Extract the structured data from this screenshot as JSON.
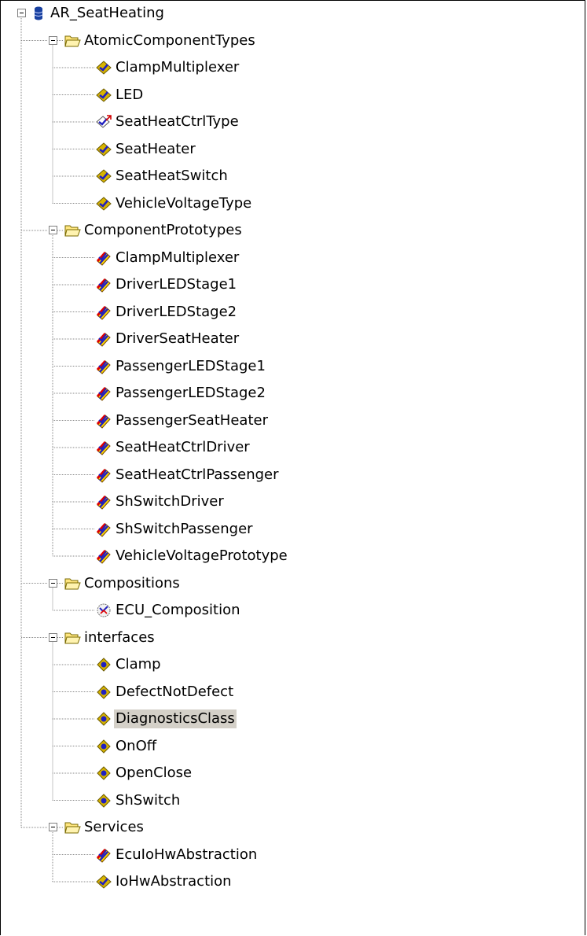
{
  "tree": {
    "root": {
      "label": "AR_SeatHeating",
      "icon": "database-icon",
      "expanded": true
    },
    "folders": [
      {
        "label": "AtomicComponentTypes",
        "icon": "folder-open-icon",
        "expanded": true,
        "items": [
          {
            "label": "ClampMultiplexer",
            "icon": "component-type-icon"
          },
          {
            "label": "LED",
            "icon": "component-type-icon"
          },
          {
            "label": "SeatHeatCtrlType",
            "icon": "application-component-type-icon"
          },
          {
            "label": "SeatHeater",
            "icon": "component-type-icon"
          },
          {
            "label": "SeatHeatSwitch",
            "icon": "component-type-icon"
          },
          {
            "label": "VehicleVoltageType",
            "icon": "component-type-icon"
          }
        ]
      },
      {
        "label": "ComponentPrototypes",
        "icon": "folder-open-icon",
        "expanded": true,
        "items": [
          {
            "label": "ClampMultiplexer",
            "icon": "component-prototype-icon"
          },
          {
            "label": "DriverLEDStage1",
            "icon": "component-prototype-icon"
          },
          {
            "label": "DriverLEDStage2",
            "icon": "component-prototype-icon"
          },
          {
            "label": "DriverSeatHeater",
            "icon": "component-prototype-icon"
          },
          {
            "label": "PassengerLEDStage1",
            "icon": "component-prototype-icon"
          },
          {
            "label": "PassengerLEDStage2",
            "icon": "component-prototype-icon"
          },
          {
            "label": "PassengerSeatHeater",
            "icon": "component-prototype-icon"
          },
          {
            "label": "SeatHeatCtrlDriver",
            "icon": "component-prototype-icon"
          },
          {
            "label": "SeatHeatCtrlPassenger",
            "icon": "component-prototype-icon"
          },
          {
            "label": "ShSwitchDriver",
            "icon": "component-prototype-icon"
          },
          {
            "label": "ShSwitchPassenger",
            "icon": "component-prototype-icon"
          },
          {
            "label": "VehicleVoltagePrototype",
            "icon": "component-prototype-icon"
          }
        ]
      },
      {
        "label": "Compositions",
        "icon": "folder-open-icon",
        "expanded": true,
        "items": [
          {
            "label": "ECU_Composition",
            "icon": "composition-icon"
          }
        ]
      },
      {
        "label": "interfaces",
        "icon": "folder-open-icon",
        "expanded": true,
        "items": [
          {
            "label": "Clamp",
            "icon": "interface-icon"
          },
          {
            "label": "DefectNotDefect",
            "icon": "interface-icon"
          },
          {
            "label": "DiagnosticsClass",
            "icon": "interface-icon",
            "selected": true
          },
          {
            "label": "OnOff",
            "icon": "interface-icon"
          },
          {
            "label": "OpenClose",
            "icon": "interface-icon"
          },
          {
            "label": "ShSwitch",
            "icon": "interface-icon"
          }
        ]
      },
      {
        "label": "Services",
        "icon": "folder-open-icon",
        "expanded": true,
        "items": [
          {
            "label": "EcuIoHwAbstraction",
            "icon": "component-prototype-icon"
          },
          {
            "label": "IoHwAbstraction",
            "icon": "component-type-icon"
          }
        ]
      }
    ]
  },
  "colors": {
    "selection": "#d4d0c8",
    "folder": "#ffe680",
    "type_gold": "#d8b400",
    "type_blue": "#2020c0",
    "prototype_red": "#e00000",
    "prototype_yellow": "#ffd800",
    "database_blue": "#1840a0"
  }
}
